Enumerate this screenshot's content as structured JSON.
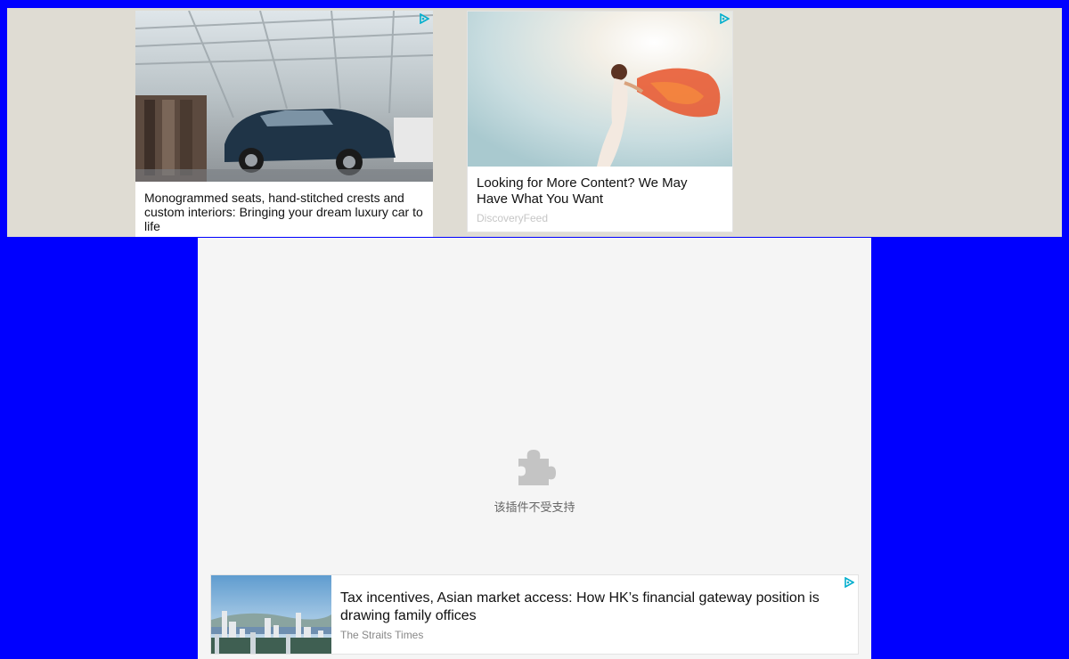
{
  "ads": {
    "card1": {
      "title": "Monogrammed seats, hand-stitched crests and custom interiors: Bringing your dream luxury car to life",
      "image_icon": "luxury-suv-showroom-photo"
    },
    "card2": {
      "title": "Looking for More Content? We May Have What You Want",
      "source": "DiscoveryFeed",
      "image_icon": "woman-orange-scarf-photo"
    },
    "card3": {
      "title": "Tax incentives, Asian market access: How HK’s financial gateway position is drawing family offices",
      "source": "The Straits Times",
      "image_icon": "hong-kong-skyline-photo"
    }
  },
  "plugin": {
    "message": "该插件不受支持",
    "icon": "puzzle-piece-icon"
  },
  "colors": {
    "page_bg": "#0000ff",
    "strip_bg": "#dfdcd3",
    "panel_bg": "#f5f5f5",
    "adchoices": "#00aecd"
  }
}
